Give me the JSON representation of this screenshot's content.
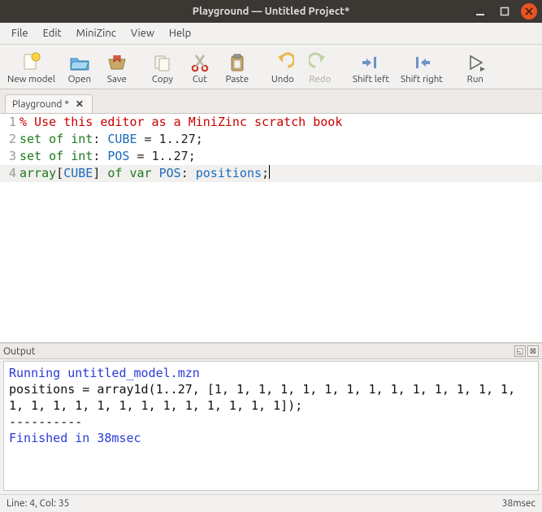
{
  "window": {
    "title": "Playground — Untitled Project*"
  },
  "menu": {
    "file": "File",
    "edit": "Edit",
    "minizinc": "MiniZinc",
    "view": "View",
    "help": "Help"
  },
  "toolbar": {
    "new_model": "New model",
    "open": "Open",
    "save": "Save",
    "copy": "Copy",
    "cut": "Cut",
    "paste": "Paste",
    "undo": "Undo",
    "redo": "Redo",
    "shift_left": "Shift left",
    "shift_right": "Shift right",
    "run": "Run"
  },
  "tab": {
    "label": "Playground *",
    "close_glyph": "✕"
  },
  "editor": {
    "lines": [
      {
        "n": "1",
        "tokens": [
          {
            "c": "tok-comment",
            "t": "% Use this editor as a MiniZinc scratch book"
          }
        ]
      },
      {
        "n": "2",
        "tokens": [
          {
            "c": "tok-kw",
            "t": "set of int"
          },
          {
            "c": "tok-punc",
            "t": ": "
          },
          {
            "c": "tok-ident",
            "t": "CUBE"
          },
          {
            "c": "tok-punc",
            "t": " = "
          },
          {
            "c": "tok-num",
            "t": "1..27"
          },
          {
            "c": "tok-punc",
            "t": ";"
          }
        ]
      },
      {
        "n": "3",
        "tokens": [
          {
            "c": "tok-kw",
            "t": "set of int"
          },
          {
            "c": "tok-punc",
            "t": ": "
          },
          {
            "c": "tok-ident",
            "t": "POS"
          },
          {
            "c": "tok-punc",
            "t": " = "
          },
          {
            "c": "tok-num",
            "t": "1..27"
          },
          {
            "c": "tok-punc",
            "t": ";"
          }
        ]
      },
      {
        "n": "4",
        "current": true,
        "tokens": [
          {
            "c": "tok-kw",
            "t": "array"
          },
          {
            "c": "tok-punc",
            "t": "["
          },
          {
            "c": "tok-ident",
            "t": "CUBE"
          },
          {
            "c": "tok-punc",
            "t": "] "
          },
          {
            "c": "tok-kw",
            "t": "of var "
          },
          {
            "c": "tok-ident",
            "t": "POS"
          },
          {
            "c": "tok-punc",
            "t": ": "
          },
          {
            "c": "tok-ident",
            "t": "positions"
          },
          {
            "c": "tok-punc",
            "t": ";"
          }
        ],
        "caret_after": true
      }
    ]
  },
  "output_panel": {
    "label": "Output",
    "lines": [
      {
        "c": "out-blue",
        "t": "Running untitled_model.mzn"
      },
      {
        "c": "out-black",
        "t": "positions = array1d(1..27, [1, 1, 1, 1, 1, 1, 1, 1, 1, 1, 1, 1, 1, 1, 1, 1, 1, 1, 1, 1, 1, 1, 1, 1, 1, 1, 1]);"
      },
      {
        "c": "out-black",
        "t": "----------"
      },
      {
        "c": "out-blue",
        "t": "Finished in 38msec"
      }
    ]
  },
  "status": {
    "cursor": "Line: 4, Col: 35",
    "timing": "38msec"
  }
}
